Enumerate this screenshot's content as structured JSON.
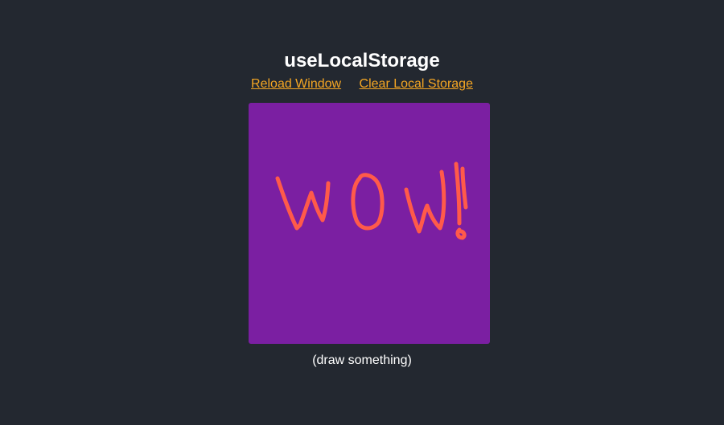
{
  "header": {
    "title": "useLocalStorage"
  },
  "links": {
    "reload_label": "Reload Window",
    "clear_label": "Clear Local Storage"
  },
  "canvas": {
    "background_color": "#7b1fa2",
    "stroke_color": "#ff5a4a",
    "drawing": "WOW!"
  },
  "caption": {
    "text": "(draw something)"
  },
  "colors": {
    "page_background": "#232830",
    "link": "#f5a623",
    "text": "#ffffff"
  }
}
